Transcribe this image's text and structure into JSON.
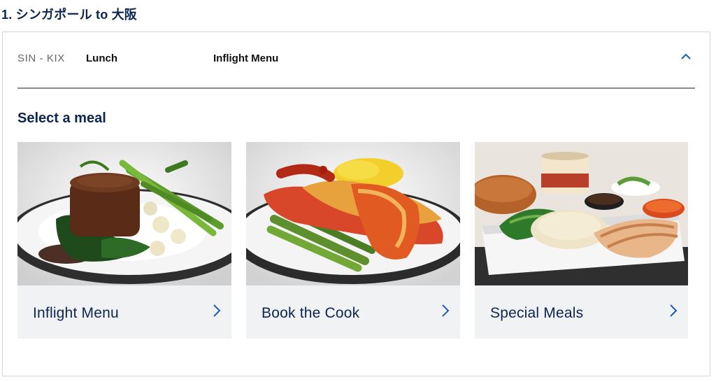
{
  "section": {
    "title": "1. シンガポール to 大阪"
  },
  "header": {
    "route": "SIN - KIX",
    "meal_time": "Lunch",
    "menu_type": "Inflight Menu",
    "collapse_icon": "chevron-up-icon"
  },
  "selection": {
    "heading": "Select a meal",
    "cards": [
      {
        "label": "Inflight Menu",
        "image": "steak-dish-photo",
        "icon": "chevron-right-icon"
      },
      {
        "label": "Book the Cook",
        "image": "lobster-dish-photo",
        "icon": "chevron-right-icon"
      },
      {
        "label": "Special Meals",
        "image": "chicken-rice-tray-photo",
        "icon": "chevron-right-icon"
      }
    ]
  },
  "colors": {
    "brand_navy": "#0c2453",
    "accent_blue": "#1d5bb8",
    "card_bg": "#f1f2f4",
    "border": "#d6d6d6"
  }
}
